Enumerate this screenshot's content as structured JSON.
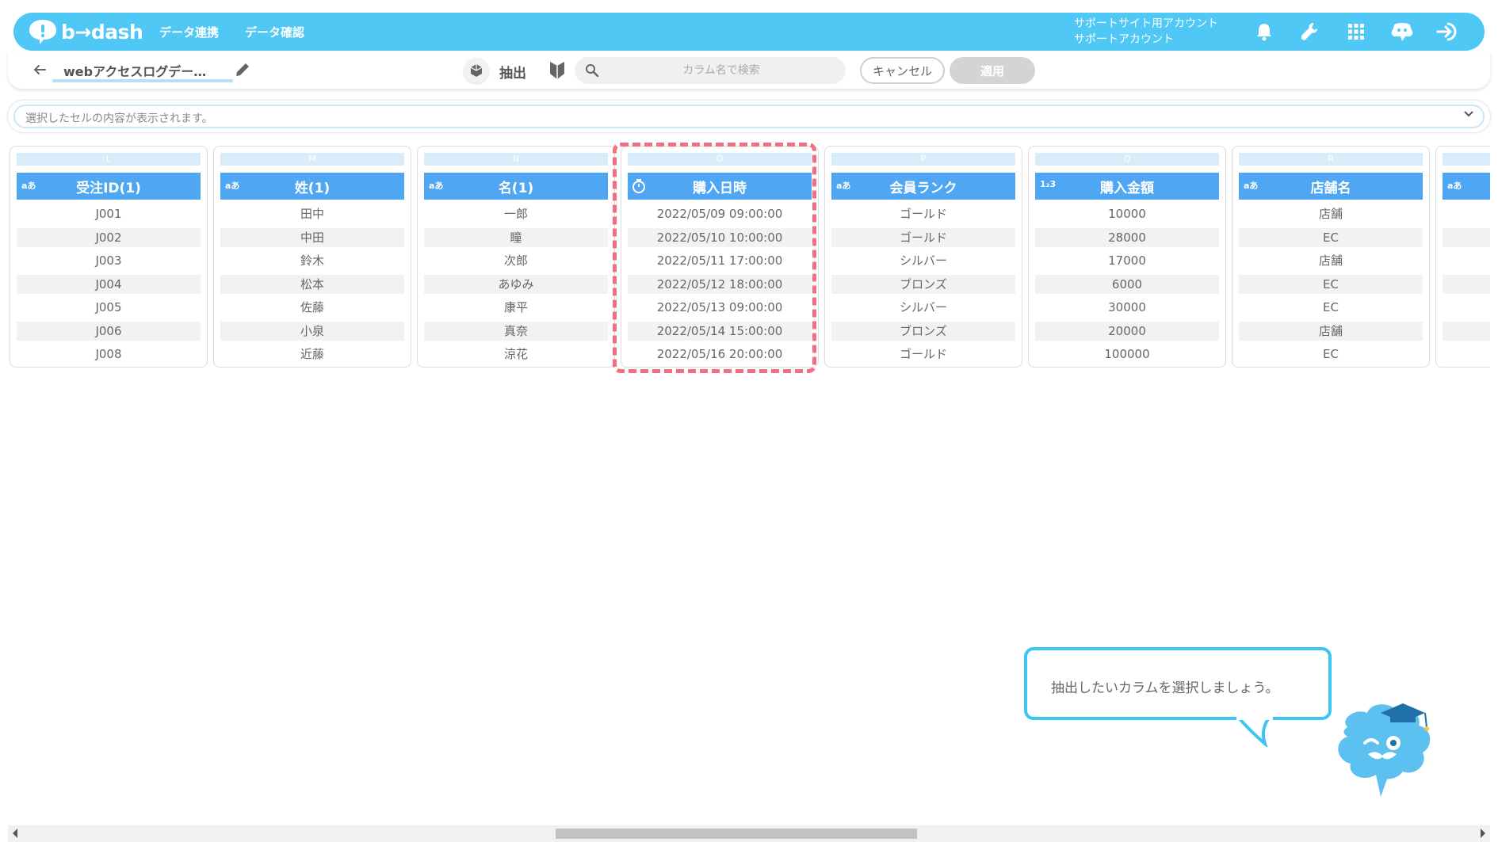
{
  "header": {
    "brand": "b→dash",
    "nav": [
      "データ連携",
      "データ確認"
    ],
    "account_line1": "サポートサイト用アカウント",
    "account_line2": "サポートアカウント",
    "icons": [
      "bell-icon",
      "wrench-icon",
      "apps-grid-icon",
      "chat-bot-icon",
      "logout-icon"
    ]
  },
  "toolbar": {
    "data_name": "webアクセスログデー…",
    "mode_label": "抽出",
    "search_placeholder": "カラム名で検索",
    "cancel_label": "キャンセル",
    "apply_label": "適用"
  },
  "cellbar": {
    "placeholder": "選択したセルの内容が表示されます。"
  },
  "columns": [
    {
      "letter": "L",
      "type": "aあ",
      "name": "受注ID(1)",
      "cells": [
        "J001",
        "J002",
        "J003",
        "J004",
        "J005",
        "J006",
        "J008"
      ]
    },
    {
      "letter": "M",
      "type": "aあ",
      "name": "姓(1)",
      "cells": [
        "田中",
        "中田",
        "鈴木",
        "松本",
        "佐藤",
        "小泉",
        "近藤"
      ]
    },
    {
      "letter": "N",
      "type": "aあ",
      "name": "名(1)",
      "cells": [
        "一郎",
        "瞳",
        "次郎",
        "あゆみ",
        "康平",
        "真奈",
        "涼花"
      ]
    },
    {
      "letter": "O",
      "type": "clock",
      "name": "購入日時",
      "cells": [
        "2022/05/09 09:00:00",
        "2022/05/10 10:00:00",
        "2022/05/11 17:00:00",
        "2022/05/12 18:00:00",
        "2022/05/13 09:00:00",
        "2022/05/14 15:00:00",
        "2022/05/16 20:00:00"
      ]
    },
    {
      "letter": "P",
      "type": "aあ",
      "name": "会員ランク",
      "cells": [
        "ゴールド",
        "ゴールド",
        "シルバー",
        "ブロンズ",
        "シルバー",
        "ブロンズ",
        "ゴールド"
      ]
    },
    {
      "letter": "Q",
      "type": "1₂3",
      "name": "購入金額",
      "cells": [
        "10000",
        "28000",
        "17000",
        "6000",
        "30000",
        "20000",
        "100000"
      ]
    },
    {
      "letter": "R",
      "type": "aあ",
      "name": "店舗名",
      "cells": [
        "店舗",
        "EC",
        "店舗",
        "EC",
        "EC",
        "店舗",
        "EC"
      ]
    },
    {
      "letter": "",
      "type": "aあ",
      "name": "",
      "cells": [
        "",
        "",
        "",
        "",
        "",
        "",
        ""
      ]
    }
  ],
  "tooltip": {
    "text": "抽出したいカラムを選択しましょう。"
  },
  "colors": {
    "header_bg": "#4fc8f6",
    "column_header": "#4fa7f3",
    "highlight": "#f07080",
    "tooltip_border": "#3cc4f2"
  }
}
